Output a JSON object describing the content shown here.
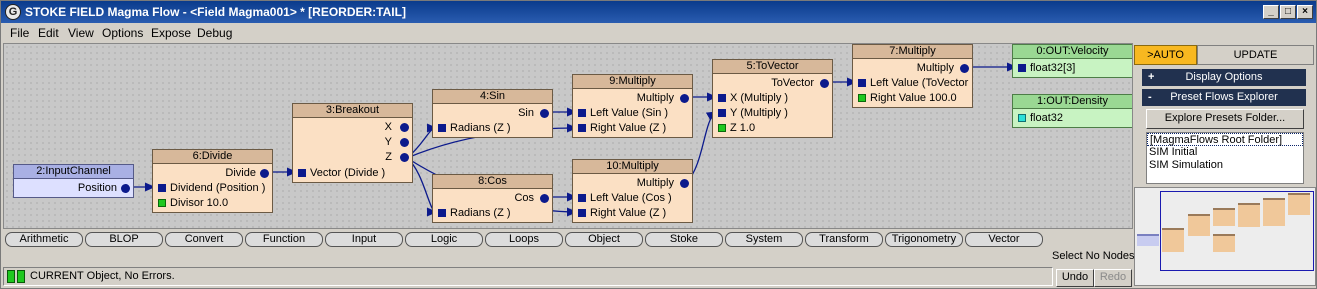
{
  "window": {
    "title": "STOKE FIELD Magma Flow - <Field Magma001> *  [REORDER:TAIL]",
    "minimize": "_",
    "restore": "□",
    "close": "×"
  },
  "menu": [
    "File",
    "Edit",
    "View",
    "Options",
    "Expose",
    "Debug"
  ],
  "nodes": {
    "n2": {
      "title": "2:InputChannel",
      "out": "Position"
    },
    "n6": {
      "title": "6:Divide",
      "out": "Divide",
      "in1": "Dividend (Position )",
      "in2": "Divisor 10.0"
    },
    "n3": {
      "title": "3:Breakout",
      "x": "X",
      "y": "Y",
      "z": "Z",
      "in1": "Vector (Divide )"
    },
    "n4": {
      "title": "4:Sin",
      "out": "Sin",
      "in1": "Radians (Z )"
    },
    "n8": {
      "title": "8:Cos",
      "out": "Cos",
      "in1": "Radians (Z )"
    },
    "n9": {
      "title": "9:Multiply",
      "out": "Multiply",
      "in1": "Left Value (Sin )",
      "in2": "Right Value (Z )"
    },
    "n10": {
      "title": "10:Multiply",
      "out": "Multiply",
      "in1": "Left Value (Cos )",
      "in2": "Right Value (Z )"
    },
    "n5": {
      "title": "5:ToVector",
      "out": "ToVector",
      "in1": "X (Multiply )",
      "in2": "Y (Multiply )",
      "in3": "Z 1.0"
    },
    "n7": {
      "title": "7:Multiply",
      "out": "Multiply",
      "in1": "Left Value (ToVector",
      "in2": "Right Value 100.0"
    },
    "o0": {
      "title": "0:OUT:Velocity",
      "in1": "float32[3]"
    },
    "o1": {
      "title": "1:OUT:Density",
      "in1": "float32"
    }
  },
  "categories": [
    "Arithmetic",
    "BLOP",
    "Convert",
    "Function",
    "Input",
    "Logic",
    "Loops",
    "Object",
    "Stoke",
    "System",
    "Transform",
    "Trigonometry",
    "Vector"
  ],
  "right_panel": {
    "auto_label": ">AUTO",
    "update_label": "UPDATE",
    "display_options": {
      "toggle": "+",
      "label": "Display Options"
    },
    "presets_explorer": {
      "toggle": "-",
      "label": "Preset Flows Explorer"
    },
    "explore_button": "Explore Presets Folder...",
    "presets": [
      "[MagmaFlows Root Folder]",
      "SIM Initial",
      "SIM Simulation"
    ]
  },
  "status": {
    "message": "CURRENT Object, No Errors.",
    "select_no_nodes": "Select No Nodes",
    "undo": "Undo",
    "redo": "Redo"
  },
  "colors": {
    "title_bar": "#0a3b8c",
    "node_body": "#fbe0c4",
    "node_header": "#d7b89a",
    "input_node": "#dde0ff",
    "output_node": "#c8f3c2",
    "wire": "#0c1a8c",
    "auto_button": "#f8b820",
    "status_ok": "#1fc81f"
  }
}
